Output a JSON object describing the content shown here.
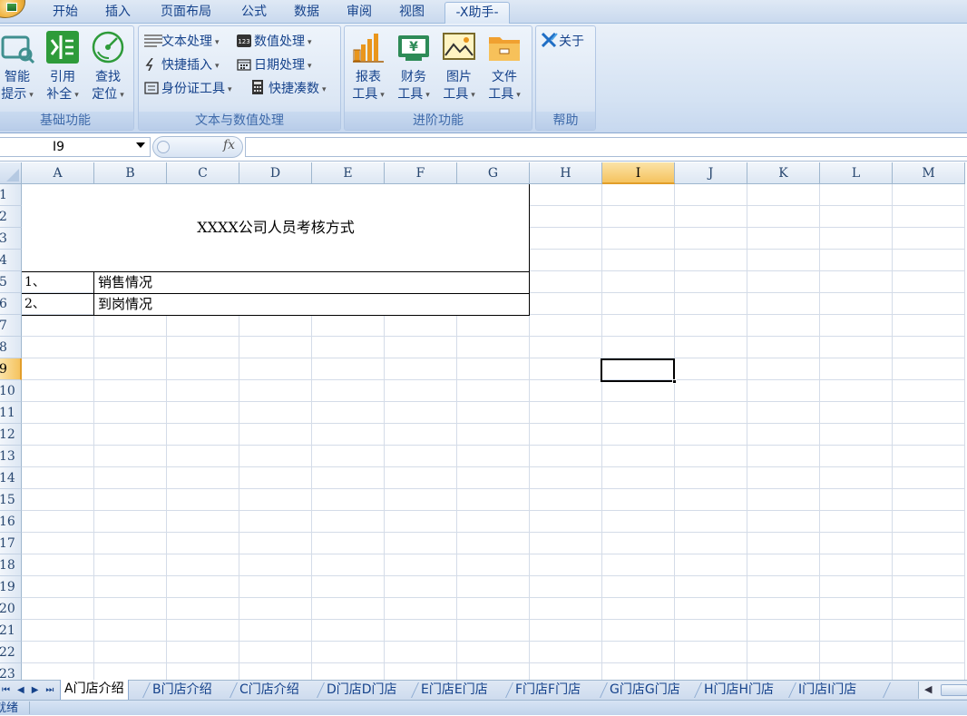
{
  "tabs": [
    {
      "label": "开始"
    },
    {
      "label": "插入"
    },
    {
      "label": "页面布局"
    },
    {
      "label": "公式"
    },
    {
      "label": "数据"
    },
    {
      "label": "审阅"
    },
    {
      "label": "视图"
    },
    {
      "label": "-X助手-",
      "active": true
    }
  ],
  "ribbon": {
    "groups": {
      "basic": {
        "label": "基础功能",
        "buttons": [
          {
            "line1": "智能",
            "line2": "提示",
            "icon": "smart-hint-icon"
          },
          {
            "line1": "引用",
            "line2": "补全",
            "icon": "reference-complete-icon"
          },
          {
            "line1": "查找",
            "line2": "定位",
            "icon": "find-locate-icon"
          }
        ]
      },
      "text_value": {
        "label": "文本与数值处理",
        "items": [
          {
            "label": "文本处理",
            "icon": "text-lines-icon"
          },
          {
            "label": "数值处理",
            "icon": "number-123-icon"
          },
          {
            "label": "快捷插入",
            "icon": "lightning-icon"
          },
          {
            "label": "日期处理",
            "icon": "calendar-icon"
          },
          {
            "label": "身份证工具",
            "icon": "id-card-icon"
          },
          {
            "label": "快捷凑数",
            "icon": "calculator-icon"
          }
        ]
      },
      "advanced": {
        "label": "进阶功能",
        "buttons": [
          {
            "line1": "报表",
            "line2": "工具",
            "icon": "report-chart-icon"
          },
          {
            "line1": "财务",
            "line2": "工具",
            "icon": "finance-yen-icon"
          },
          {
            "line1": "图片",
            "line2": "工具",
            "icon": "picture-icon"
          },
          {
            "line1": "文件",
            "line2": "工具",
            "icon": "folder-icon"
          }
        ]
      },
      "help": {
        "label": "帮助",
        "about": "关于",
        "icon": "x-logo-icon"
      }
    }
  },
  "formula_bar": {
    "name_box": "I9",
    "fx": "fx",
    "formula": ""
  },
  "grid": {
    "columns": [
      "A",
      "B",
      "C",
      "D",
      "E",
      "F",
      "G",
      "H",
      "I",
      "J",
      "K",
      "L",
      "M"
    ],
    "rows": [
      "1",
      "2",
      "3",
      "4",
      "5",
      "6",
      "7",
      "8",
      "9",
      "10",
      "11",
      "12",
      "13",
      "14",
      "15",
      "16",
      "17",
      "18",
      "19",
      "20",
      "21",
      "22",
      "23"
    ],
    "selected_column": "I",
    "selected_row": "9",
    "cells": {
      "title": "XXXX公司人员考核方式",
      "a5": "1、",
      "b5": "销售情况",
      "a6": "2、",
      "b6": "到岗情况"
    }
  },
  "sheets": [
    {
      "label": "A门店介绍",
      "active": true
    },
    {
      "label": "B门店介绍"
    },
    {
      "label": "C门店介绍"
    },
    {
      "label": "D门店D门店"
    },
    {
      "label": "E门店E门店"
    },
    {
      "label": "F门店F门店"
    },
    {
      "label": "G门店G门店"
    },
    {
      "label": "H门店H门店"
    },
    {
      "label": "I门店I门店"
    }
  ],
  "status": {
    "text": "就绪"
  },
  "colors": {
    "accent": "#15428b",
    "selected_header": "#f5c35f",
    "ribbon_bg": "#d4e2f3"
  }
}
